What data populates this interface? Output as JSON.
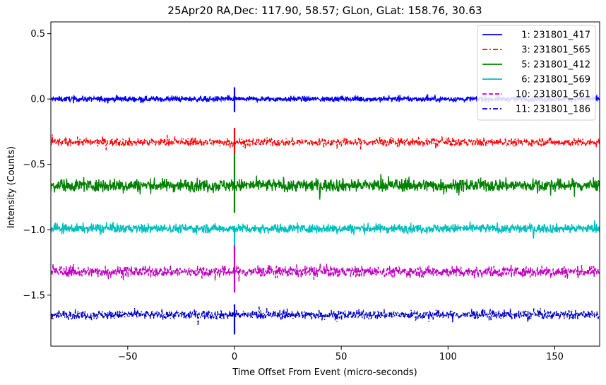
{
  "chart_data": {
    "type": "line",
    "title": "25Apr20 RA,Dec:  117.90,  58.57; GLon, GLat:  158.76,  30.63",
    "xlabel": "Time Offset From Event (micro-seconds)",
    "ylabel": "Intensity (Counts)",
    "xlim": [
      -86,
      171
    ],
    "ylim": [
      -1.89,
      0.59
    ],
    "xticks": [
      -50,
      0,
      50,
      100,
      150
    ],
    "xtick_labels": [
      "−50",
      "0",
      "50",
      "100",
      "150"
    ],
    "yticks": [
      0.5,
      0.0,
      -0.5,
      -1.0,
      -1.5
    ],
    "ytick_labels": [
      "0.5",
      "0.0",
      "−0.5",
      "−1.0",
      "−1.5"
    ],
    "grid": false,
    "legend_position": "top-right",
    "series": [
      {
        "name": "1: 231801_417",
        "color": "#0000ff",
        "dash": "solid",
        "offset": 0.0,
        "noise": 0.015,
        "spike": [
          -0.1,
          0.09
        ]
      },
      {
        "name": "3: 231801_565",
        "color": "#ff0000",
        "dash": "dashdot",
        "offset": -0.33,
        "noise": 0.022,
        "spike": [
          -0.42,
          -0.22
        ]
      },
      {
        "name": "5: 231801_412",
        "color": "#008000",
        "dash": "solid",
        "offset": -0.66,
        "noise": 0.035,
        "spike": [
          -0.87,
          -0.42
        ]
      },
      {
        "name": "6: 231801_569",
        "color": "#00bfbf",
        "dash": "solid",
        "offset": -0.99,
        "noise": 0.025,
        "spike": [
          -1.18,
          -0.97
        ]
      },
      {
        "name": "10: 231801_561",
        "color": "#bf00bf",
        "dash": "dashed",
        "offset": -1.32,
        "noise": 0.03,
        "spike": [
          -1.48,
          -1.12
        ]
      },
      {
        "name": "11: 231801_186",
        "color": "#0000cc",
        "dash": "dashdot",
        "offset": -1.65,
        "noise": 0.025,
        "spike": [
          -1.8,
          -1.57
        ]
      }
    ]
  }
}
